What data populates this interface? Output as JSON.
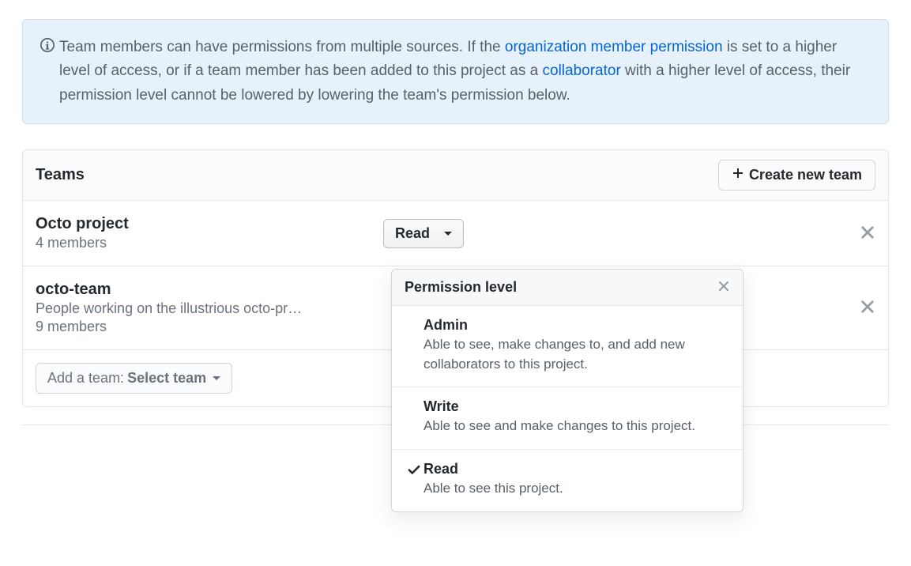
{
  "banner": {
    "text_before_link1": "Team members can have permissions from multiple sources. If the ",
    "link1": "organization member permission",
    "text_mid": " is set to a higher level of access, or if a team member has been added to this project as a ",
    "link2": "collaborator",
    "text_after": " with a higher level of access, their permission level cannot be lowered by lowering the team's permission below."
  },
  "header": {
    "title": "Teams",
    "create_button": "Create new team"
  },
  "teams": [
    {
      "name": "Octo project",
      "desc": "",
      "members": "4 members",
      "permission": "Read"
    },
    {
      "name": "octo-team",
      "desc": "People working on the illustrious octo-pr…",
      "members": "9 members",
      "permission": ""
    }
  ],
  "footer": {
    "add_team_prefix": "Add a team: ",
    "add_team_label": "Select team"
  },
  "popover": {
    "title": "Permission level",
    "options": [
      {
        "title": "Admin",
        "desc": "Able to see, make changes to, and add new collaborators to this project.",
        "selected": false
      },
      {
        "title": "Write",
        "desc": "Able to see and make changes to this project.",
        "selected": false
      },
      {
        "title": "Read",
        "desc": "Able to see this project.",
        "selected": true
      }
    ]
  }
}
